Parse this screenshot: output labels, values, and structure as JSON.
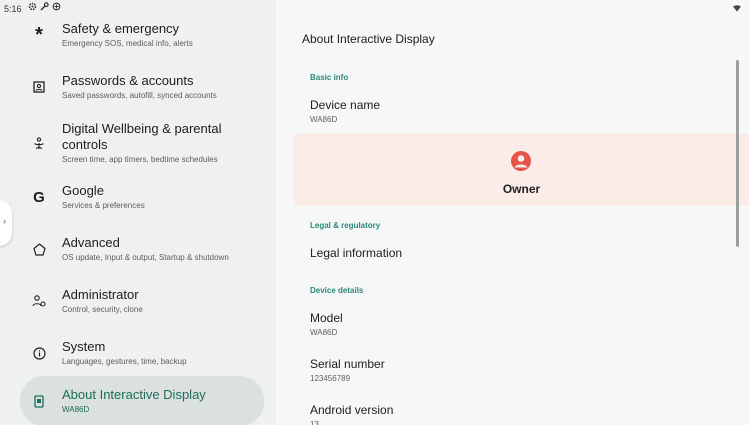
{
  "status": {
    "time": "5:16"
  },
  "sidebar": {
    "items": [
      {
        "title": "Safety & emergency",
        "sub": "Emergency SOS, medical info, alerts"
      },
      {
        "title": "Passwords & accounts",
        "sub": "Saved passwords, autofill, synced accounts"
      },
      {
        "title": "Digital Wellbeing & parental controls",
        "sub": "Screen time, app timers, bedtime schedules"
      },
      {
        "title": "Google",
        "sub": "Services & preferences"
      },
      {
        "title": "Advanced",
        "sub": "OS update, Input & output, Startup & shutdown"
      },
      {
        "title": "Administrator",
        "sub": "Control, security, clone"
      },
      {
        "title": "System",
        "sub": "Languages, gestures, time, backup"
      },
      {
        "title": "About Interactive Display",
        "sub": "WA86D"
      }
    ]
  },
  "main": {
    "title": "About Interactive Display",
    "basic_info": "Basic info",
    "device_name": {
      "title": "Device name",
      "value": "WA86D"
    },
    "owner": "Owner",
    "legal_section": "Legal & regulatory",
    "legal_info": "Legal information",
    "device_details": "Device details",
    "model": {
      "title": "Model",
      "value": "WA86D"
    },
    "serial": {
      "title": "Serial number",
      "value": "123456789"
    },
    "android": {
      "title": "Android version",
      "value": "13"
    }
  },
  "colors": {
    "accent": "#1f6b57",
    "owner_icon": "#e5534b",
    "section": "#2d8676"
  }
}
